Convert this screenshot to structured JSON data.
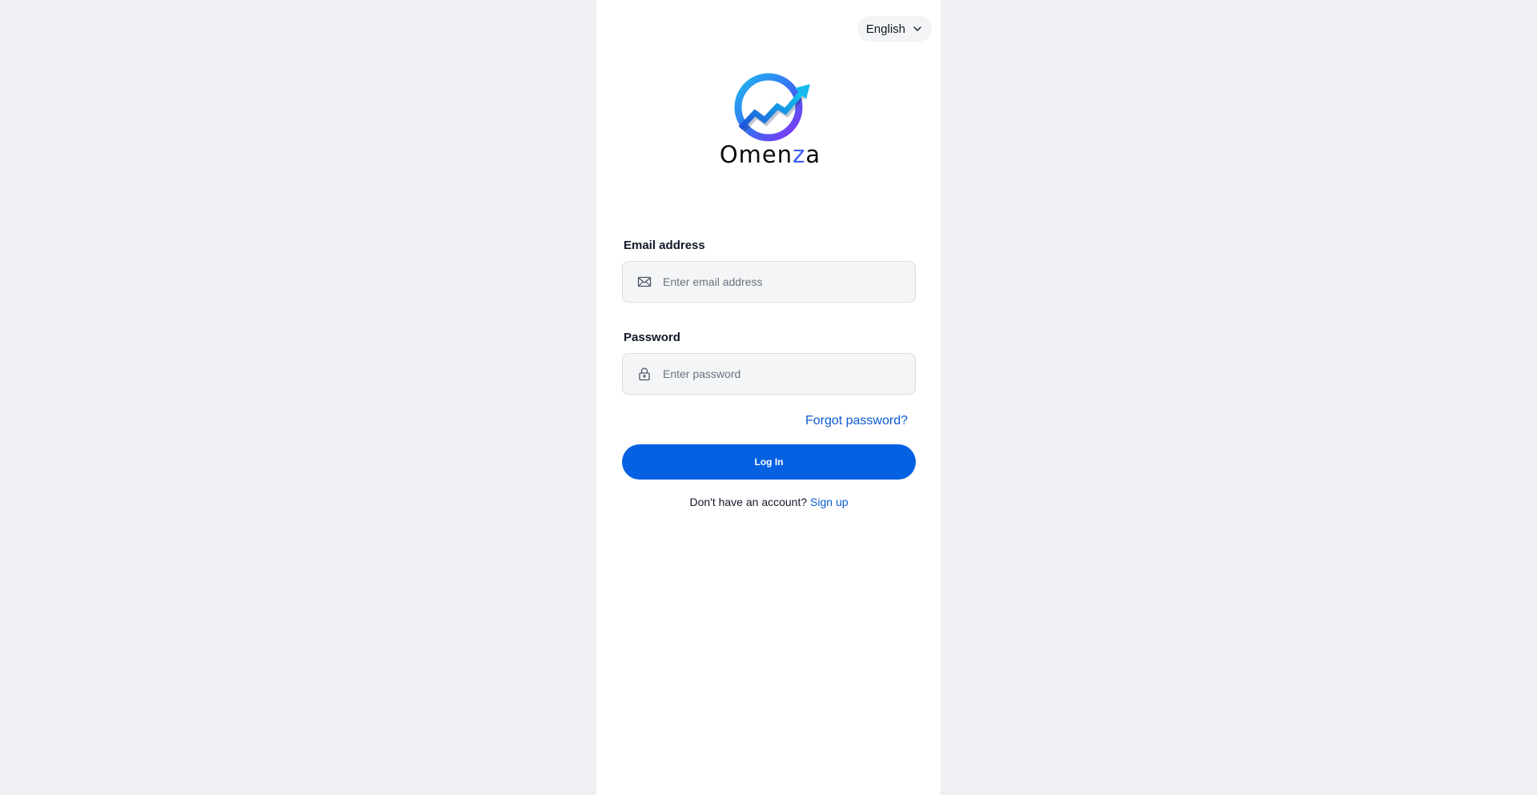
{
  "language": {
    "selected": "English",
    "icon": "chevron-down-icon"
  },
  "brand": {
    "name_prefix": "Omen",
    "name_accent": "z",
    "name_suffix": "a",
    "colors": {
      "ring_start": "#1fb6f0",
      "ring_end": "#7b2ff7",
      "arrow": "#1aa4e8",
      "accent_letter": "#3b5bf5"
    }
  },
  "form": {
    "email": {
      "label": "Email address",
      "placeholder": "Enter email address",
      "value": "",
      "icon": "envelope-icon"
    },
    "password": {
      "label": "Password",
      "placeholder": "Enter password",
      "value": "",
      "icon": "lock-icon"
    },
    "forgot_label": "Forgot password?",
    "login_label": "Log In",
    "signup_prompt": "Don't have an account?",
    "signup_label": "Sign up"
  },
  "colors": {
    "page_bg": "#eef0f3",
    "panel_bg": "#ffffff",
    "primary": "#0561e2",
    "link": "#0a5bd3"
  }
}
